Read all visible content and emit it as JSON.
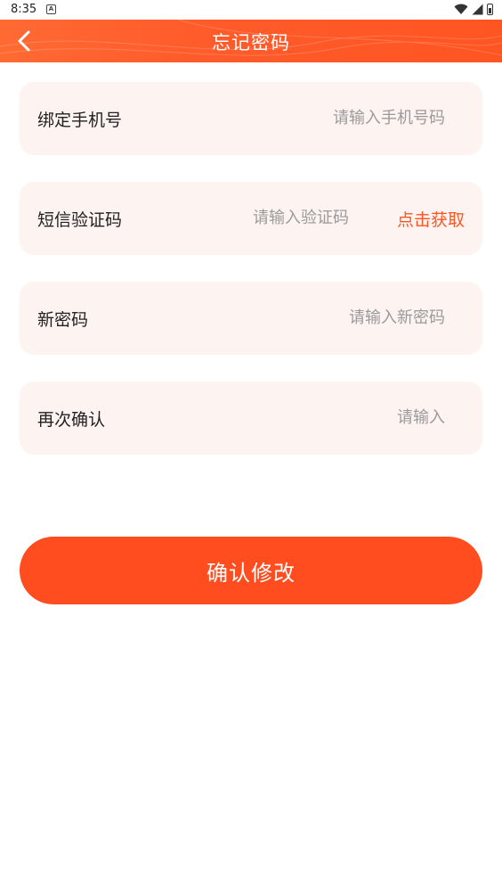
{
  "status_bar": {
    "time": "8:35",
    "notification_icon": "A"
  },
  "header": {
    "title": "忘记密码",
    "back_icon": "chevron-left-icon"
  },
  "form": {
    "phone": {
      "label": "绑定手机号",
      "placeholder": "请输入手机号码",
      "value": ""
    },
    "sms_code": {
      "label": "短信验证码",
      "placeholder": "请输入验证码",
      "value": "",
      "get_code_label": "点击获取"
    },
    "new_password": {
      "label": "新密码",
      "placeholder": "请输入新密码",
      "value": ""
    },
    "confirm_password": {
      "label": "再次确认",
      "placeholder": "请输入",
      "value": ""
    }
  },
  "submit": {
    "label": "确认修改"
  },
  "colors": {
    "accent": "#ff5522",
    "field_background": "#fdf3f0",
    "button": "#ff4d1f"
  }
}
